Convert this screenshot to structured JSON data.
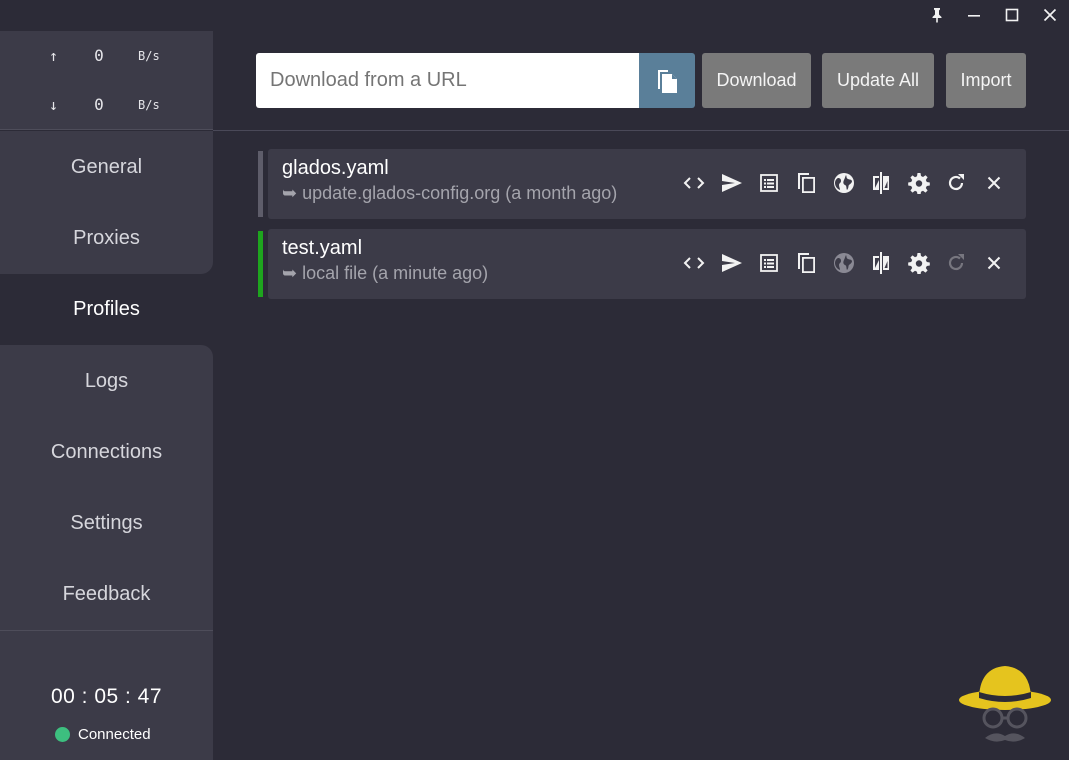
{
  "window": {
    "controls": {
      "pin": "pin-icon",
      "minimize": "minimize-icon",
      "maximize": "maximize-icon",
      "close": "close-icon"
    }
  },
  "traffic": {
    "upload": {
      "arrow": "↑",
      "value": "0",
      "unit": "B/s"
    },
    "download": {
      "arrow": "↓",
      "value": "0",
      "unit": "B/s"
    }
  },
  "nav": {
    "items": [
      {
        "label": "General"
      },
      {
        "label": "Proxies"
      },
      {
        "label": "Profiles",
        "active": true
      },
      {
        "label": "Logs"
      },
      {
        "label": "Connections"
      },
      {
        "label": "Settings"
      },
      {
        "label": "Feedback"
      }
    ]
  },
  "status": {
    "uptime": "00 : 05 : 47",
    "connection": "Connected",
    "connection_color": "#3dbf7f"
  },
  "toolbar": {
    "url_placeholder": "Download from a URL",
    "download_label": "Download",
    "update_all_label": "Update All",
    "import_label": "Import"
  },
  "profiles": [
    {
      "name": "glados.yaml",
      "source": "➥ update.glados-config.org (a month ago)",
      "selected": false,
      "indicator_color": "#5e5d6a"
    },
    {
      "name": "test.yaml",
      "source": "➥ local file (a minute ago)",
      "selected": true,
      "indicator_color": "#1ea51e"
    }
  ],
  "colors": {
    "background": "#2c2b37",
    "panel": "#3c3b48",
    "paste_button": "#5a7f99",
    "action_button": "#7a7a7a",
    "mascot_hat": "#e5c41e"
  }
}
